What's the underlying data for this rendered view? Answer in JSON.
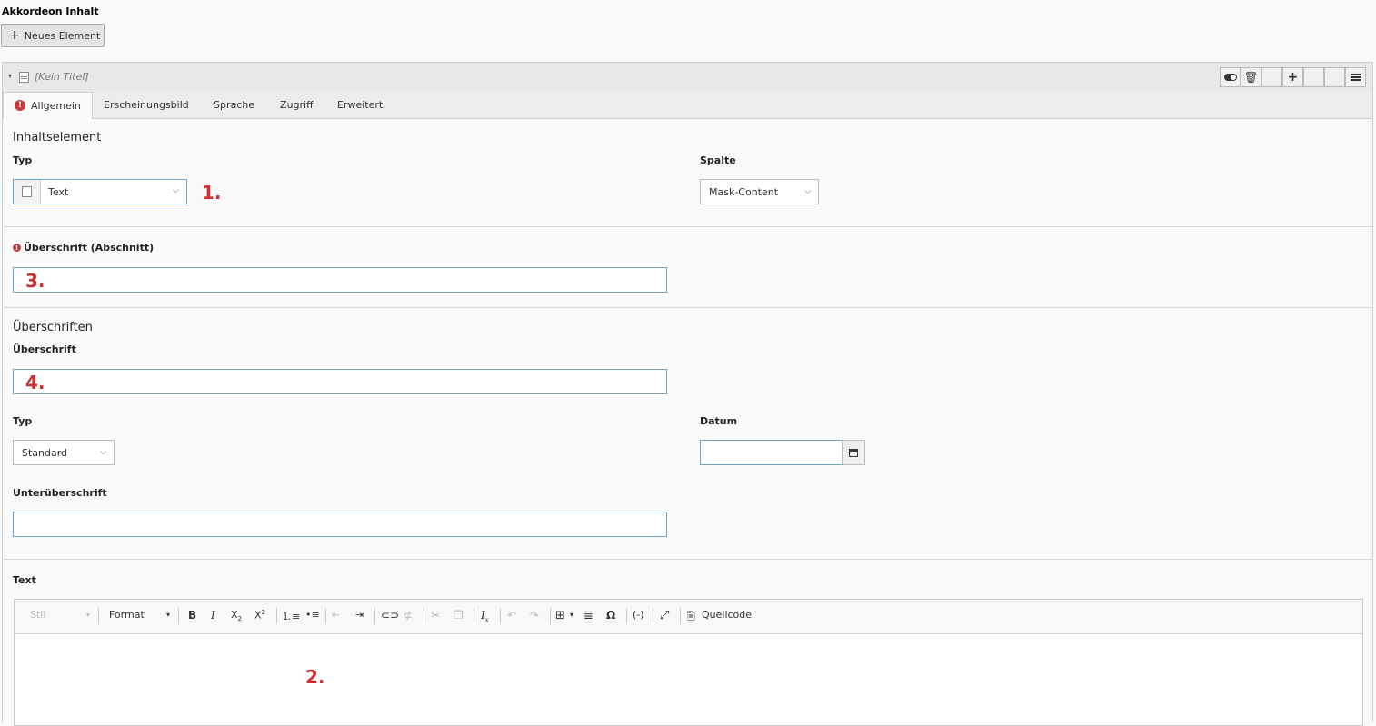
{
  "section": {
    "title": "Akkordeon Inhalt",
    "new_button": "Neues Element"
  },
  "record": {
    "title": "[Kein Titel]"
  },
  "tabs": [
    {
      "label": "Allgemein",
      "active": true,
      "error": true
    },
    {
      "label": "Erscheinungsbild"
    },
    {
      "label": "Sprache"
    },
    {
      "label": "Zugriff"
    },
    {
      "label": "Erweitert"
    }
  ],
  "inhaltselement": {
    "group_title": "Inhaltselement",
    "typ_label": "Typ",
    "typ_value": "Text",
    "spalte_label": "Spalte",
    "spalte_value": "Mask-Content"
  },
  "ueberschrift_abschnitt": {
    "label": "Überschrift (Abschnitt)",
    "value": ""
  },
  "ueberschriften": {
    "group_title": "Überschriften",
    "ueberschrift_label": "Überschrift",
    "ueberschrift_value": "",
    "typ_label": "Typ",
    "typ_value": "Standard",
    "datum_label": "Datum",
    "datum_value": "",
    "unterueberschrift_label": "Unterüberschrift",
    "unterueberschrift_value": ""
  },
  "text": {
    "label": "Text",
    "toolbar": {
      "stil": "Stil",
      "format": "Format",
      "quellcode": "Quellcode"
    }
  },
  "annotations": {
    "a1": "1.",
    "a2": "2.",
    "a3": "3.",
    "a4": "4."
  },
  "colors": {
    "annotation": "#d12f2f",
    "error": "#c83c3c",
    "input_border": "#6fa3c7"
  }
}
